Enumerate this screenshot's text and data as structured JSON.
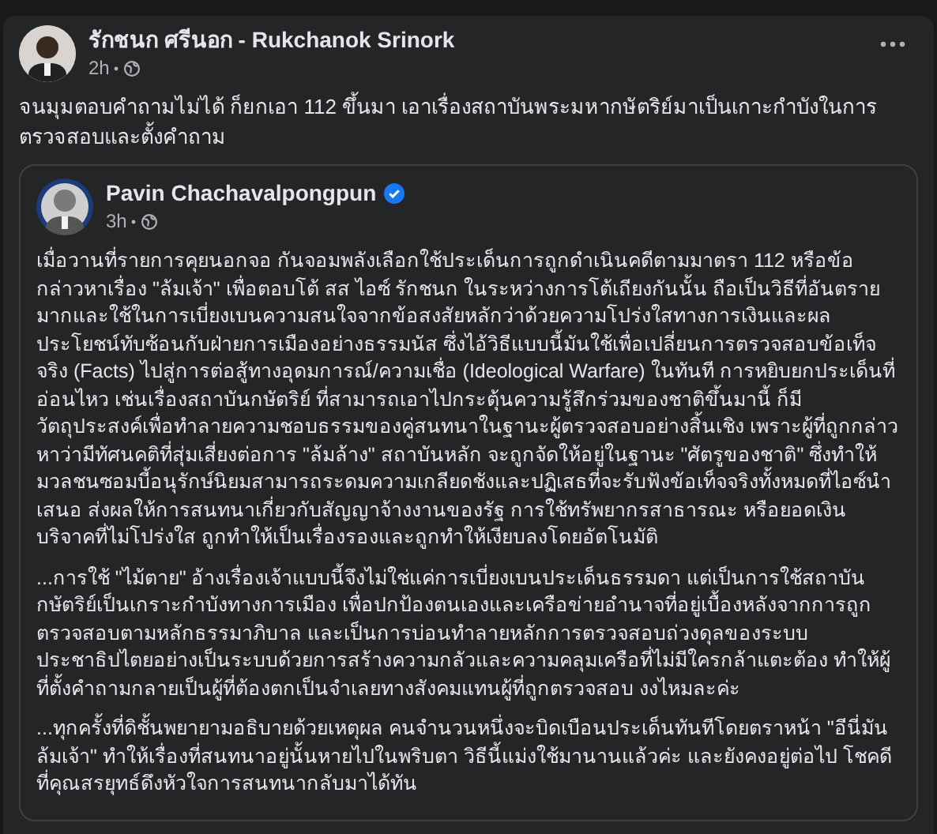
{
  "post": {
    "author": "รักชนก ศรีนอก - Rukchanok Srinork",
    "time": "2h",
    "text": "จนมุมตอบคำถามไม่ได้ ก็ยกเอา 112 ขึ้นมา เอาเรื่องสถาบันพระมหากษัตริย์มาเป็นเกาะกำบังในการตรวจสอบและตั้งคำถาม"
  },
  "shared_post": {
    "author": "Pavin Chachavalpongpun",
    "verified": true,
    "time": "3h",
    "paragraphs": [
      "เมื่อวานที่รายการคุยนอกจอ กันจอมพลังเลือกใช้ประเด็นการถูกดำเนินคดีตามมาตรา 112 หรือข้อกล่าวหาเรื่อง \"ล้มเจ้า\" เพื่อตอบโต้ สส ไอซ์ รักชนก ในระหว่างการโต้เถียงกันนั้น ถือเป็นวิธีที่อันตรายมากและใช้ในการเบี่ยงเบนความสนใจจากข้อสงสัยหลักว่าด้วยความโปร่งใสทางการเงินและผลประโยชน์ทับซ้อนกับฝ่ายการเมืองอย่างธรรมนัส ซึ่งไอ้วิธีแบบนี้มันใช้เพื่อเปลี่ยนการตรวจสอบข้อเท็จจริง (Facts) ไปสู่การต่อสู้ทางอุดมการณ์/ความเชื่อ (Ideological Warfare) ในทันที การหยิบยกประเด็นที่อ่อนไหว เช่นเรื่องสถาบันกษัตริย์ ที่สามารถเอาไปกระตุ้นความรู้สึกร่วมของชาติขึ้นมานี้ ก็มีวัตถุประสงค์เพื่อทำลายความชอบธรรมของคู่สนทนาในฐานะผู้ตรวจสอบอย่างสิ้นเชิง เพราะผู้ที่ถูกกล่าวหาว่ามีทัศนคติที่สุ่มเสี่ยงต่อการ \"ล้มล้าง\" สถาบันหลัก จะถูกจัดให้อยู่ในฐานะ \"ศัตรูของชาติ\" ซึ่งทำให้มวลชนซอมบี้อนุรักษ์นิยมสามารถระดมความเกลียดชังและปฏิเสธที่จะรับฟังข้อเท็จจริงทั้งหมดที่ไอซ์นำเสนอ ส่งผลให้การสนทนาเกี่ยวกับสัญญาจ้างงานของรัฐ การใช้ทรัพยากรสาธารณะ หรือยอดเงินบริจาคที่ไม่โปร่งใส ถูกทำให้เป็นเรื่องรองและถูกทำให้เงียบลงโดยอัตโนมัติ",
      "...การใช้ \"ไม้ตาย\" อ้างเรื่องเจ้าแบบนี้จึงไม่ใช่แค่การเบี่ยงเบนประเด็นธรรมดา แต่เป็นการใช้สถาบันกษัตริย์เป็นเกราะกำบังทางการเมือง เพื่อปกป้องตนเองและเครือข่ายอำนาจที่อยู่เบื้องหลังจากการถูกตรวจสอบตามหลักธรรมาภิบาล และเป็นการบ่อนทำลายหลักการตรวจสอบถ่วงดุลของระบบประชาธิปไตยอย่างเป็นระบบด้วยการสร้างความกลัวและความคลุมเครือที่ไม่มีใครกล้าแตะต้อง ทำให้ผู้ที่ตั้งคำถามกลายเป็นผู้ที่ต้องตกเป็นจำเลยทางสังคมแทนผู้ที่ถูกตรวจสอบ งงไหมละค่ะ",
      "...ทุกครั้งที่ดิชั้นพยายามอธิบายด้วยเหตุผล คนจำนวนหนึ่งจะบิดเบือนประเด็นทันทีโดยตราหน้า \"อีนี่มันล้มเจ้า\" ทำให้เรื่องที่สนทนาอยู่นั้นหายไปในพริบตา วิธีนี้แม่งใช้มานานแล้วค่ะ และยังคงอยู่ต่อไป โชคดีที่คุณสรยุทธ์ดึงหัวใจการสนทนากลับมาได้ทัน"
    ]
  }
}
